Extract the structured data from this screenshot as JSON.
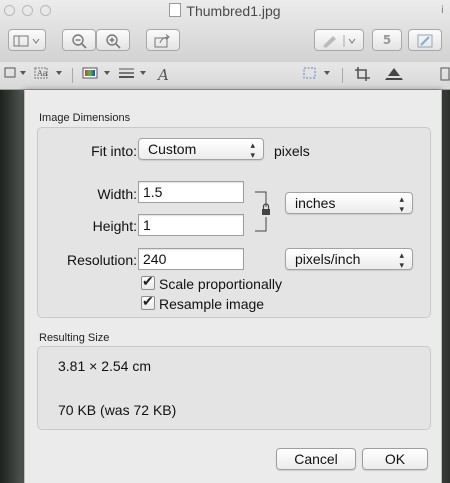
{
  "window": {
    "title": "Thumbred1.jpg",
    "edge_char": "i"
  },
  "toolbar": {
    "page_number": "5",
    "text_tool": "A"
  },
  "dialog": {
    "image_dimensions_label": "Image Dimensions",
    "fit_into_label": "Fit into:",
    "fit_into_value": "Custom",
    "fit_into_unit": "pixels",
    "width_label": "Width:",
    "width_value": "1.5",
    "height_label": "Height:",
    "height_value": "1",
    "resolution_label": "Resolution:",
    "resolution_value": "240",
    "size_unit": "inches",
    "resolution_unit": "pixels/inch",
    "scale_label": "Scale proportionally",
    "scale_checked": true,
    "resample_label": "Resample image",
    "resample_checked": true,
    "resulting_size_label": "Resulting Size",
    "resulting_dimensions": "3.81 × 2.54 cm",
    "resulting_filesize": "70 KB (was 72 KB)",
    "cancel_label": "Cancel",
    "ok_label": "OK"
  },
  "colors": {
    "dialog_bg": "#ebebeb",
    "group_bg": "#e4e4e4"
  }
}
